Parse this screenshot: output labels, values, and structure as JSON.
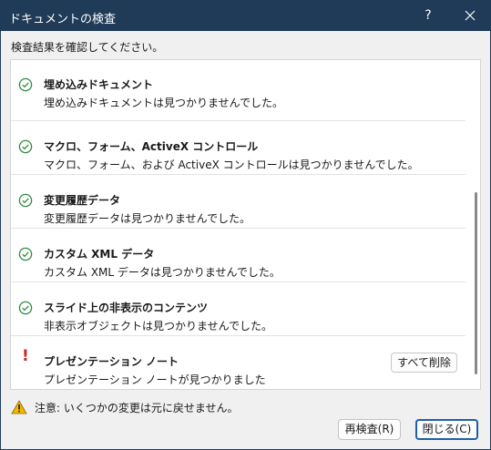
{
  "window": {
    "title": "ドキュメントの検査",
    "help_label": "?",
    "close_label": "×"
  },
  "instruction": "検査結果を確認してください。",
  "results": [
    {
      "status": "ok",
      "title": "埋め込みドキュメント",
      "description": "埋め込みドキュメントは見つかりませんでした。"
    },
    {
      "status": "ok",
      "title": "マクロ、フォーム、ActiveX コントロール",
      "description": "マクロ、フォーム、および ActiveX コントロールは見つかりませんでした。"
    },
    {
      "status": "ok",
      "title": "変更履歴データ",
      "description": "変更履歴データは見つかりませんでした。"
    },
    {
      "status": "ok",
      "title": "カスタム XML データ",
      "description": "カスタム XML データは見つかりませんでした。"
    },
    {
      "status": "ok",
      "title": "スライド上の非表示のコンテンツ",
      "description": "非表示オブジェクトは見つかりませんでした。"
    },
    {
      "status": "warning",
      "title": "プレゼンテーション ノート",
      "description": "プレゼンテーション ノートが見つかりました",
      "action_label": "すべて削除"
    }
  ],
  "status_icons": {
    "ok": "check-circle-icon",
    "warning": "exclamation-icon"
  },
  "footer": {
    "note": "注意: いくつかの変更は元に戻せません。",
    "reinspect_label": "再検査(R)",
    "close_label": "閉じる(C)"
  },
  "colors": {
    "titlebar": "#1f3b57",
    "ok_green": "#2e8b3e",
    "warning_red": "#d0201b",
    "default_button_border": "#1f5fa8"
  }
}
